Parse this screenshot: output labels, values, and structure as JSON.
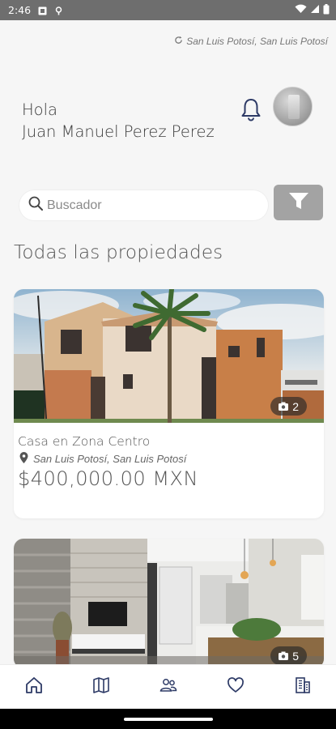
{
  "status_bar": {
    "time": "2:46",
    "icons": [
      "notification-icon",
      "vpn-icon",
      "wifi-icon",
      "signal-icon",
      "battery-icon"
    ]
  },
  "header": {
    "location": "San Luis Potosí, San Luis Potosí",
    "greeting_line1": "Hola",
    "user_name": "Juan Manuel Perez Perez"
  },
  "search": {
    "placeholder": "Buscador"
  },
  "section_title": "Todas las propiedades",
  "properties": [
    {
      "title": "Casa en Zona Centro",
      "location": "San Luis Potosí, San Luis Potosí",
      "price": "$400,000.00 MXN",
      "photo_count": "2"
    },
    {
      "photo_count": "5"
    }
  ],
  "bottom_nav": [
    "home-icon",
    "map-icon",
    "people-icon",
    "favorites-icon",
    "buildings-icon"
  ],
  "colors": {
    "accent": "#2d3a66",
    "filter_button": "#a3a3a3",
    "background": "#f6f6f6"
  }
}
